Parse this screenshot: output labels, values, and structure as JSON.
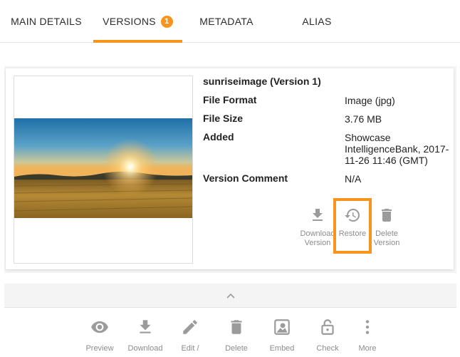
{
  "tabs": [
    {
      "label": "MAIN DETAILS"
    },
    {
      "label": "VERSIONS",
      "badge": "1"
    },
    {
      "label": "METADATA"
    },
    {
      "label": "ALIAS"
    }
  ],
  "version": {
    "title": "sunriseimage (Version 1)",
    "fields": [
      {
        "label": "File Format",
        "value": "Image (jpg)"
      },
      {
        "label": "File Size",
        "value": "3.76 MB"
      },
      {
        "label": "Added",
        "value": "Showcase IntelligenceBank, 2017-11-26 11:46 (GMT)"
      },
      {
        "label": "Version Comment",
        "value": "N/A"
      }
    ],
    "actions": {
      "download": "Download Version",
      "restore": "Restore",
      "delete": "Delete Version"
    }
  },
  "toolbar": {
    "preview": "Preview",
    "download": "Download",
    "edit": "Edit /",
    "delete": "Delete",
    "embed": "Embed",
    "check": "Check",
    "more": "More"
  },
  "colors": {
    "accent": "#f7941d",
    "icon_gray": "#9b9b9b"
  }
}
